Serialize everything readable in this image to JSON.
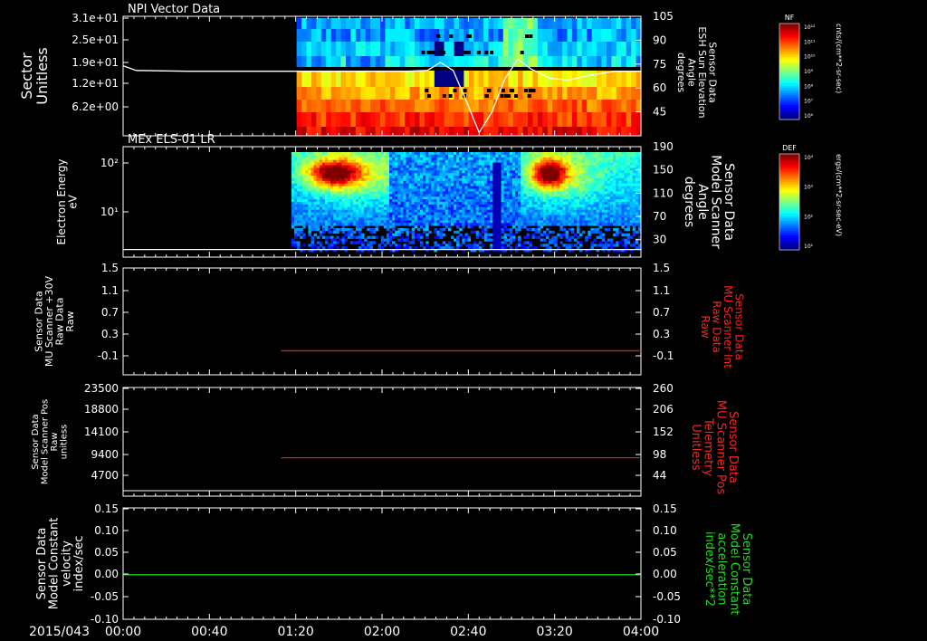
{
  "date_label": "2015/043",
  "time_ticks": [
    "00:00",
    "00:40",
    "01:20",
    "02:00",
    "02:40",
    "03:20",
    "04:00"
  ],
  "colors": {
    "background": "#000000",
    "axis": "#ffffff",
    "red_trace": "#cc2222",
    "green_trace": "#22cc22",
    "red_label": "#ff2020",
    "green_label": "#22dd22"
  },
  "colorbars": [
    {
      "title": "NF",
      "unit_label": "cnts/(cm**2-sr-sec)",
      "tick_labels": [
        "10¹²",
        "10¹¹",
        "10¹⁰",
        "10⁹",
        "10⁸",
        "10⁷",
        "10⁶"
      ]
    },
    {
      "title": "DEF",
      "unit_label": "ergs/(cm**2-sr-sec-eV)",
      "tick_labels": [
        "10⁴",
        "10³",
        "10²",
        "10¹"
      ]
    }
  ],
  "chart_data": [
    {
      "type": "heatmap",
      "title": "NPI Vector Data",
      "ylabel": [
        "Sector",
        "Unitless"
      ],
      "y_ticks": [
        "3.1e+01",
        "2.5e+01",
        "1.9e+01",
        "1.2e+01",
        "6.2e+00"
      ],
      "right_ylabel": [
        "Sensor Data",
        "ESH Sun Elevation",
        "Angle",
        "degrees"
      ],
      "right_ticks": [
        "105",
        "90",
        "75",
        "60",
        "45"
      ],
      "right_ylim": [
        30,
        105
      ],
      "data_start": "01:20",
      "overlay_line": {
        "name": "ESH Sun Elevation",
        "x_hours": [
          0.0,
          0.1,
          0.5,
          1.0,
          1.5,
          2.0,
          2.2,
          2.35,
          2.45,
          2.55,
          2.65,
          2.75,
          2.85,
          2.95,
          3.05,
          3.15,
          3.3,
          3.45,
          3.6,
          3.8,
          4.0
        ],
        "y_deg": [
          74,
          71,
          70.5,
          70.5,
          70.5,
          70.5,
          70.5,
          71,
          76,
          71,
          52,
          32,
          45,
          66,
          78,
          72,
          66,
          65,
          68,
          70.5,
          70.5
        ]
      }
    },
    {
      "type": "heatmap",
      "title": "MEx ELS-01 LR",
      "ylabel": [
        "Electron Energy",
        "eV"
      ],
      "y_ticks": [
        "10²",
        "10¹"
      ],
      "right_ylabel": [
        "Sensor Data",
        "Model Scanner",
        "Angle",
        "degrees"
      ],
      "right_ticks": [
        "190",
        "150",
        "110",
        "70",
        "30"
      ],
      "right_ylim": [
        0,
        190
      ],
      "data_start": "01:20",
      "overlay_line": {
        "name": "Model Scanner Angle",
        "x_hours": [
          0.0,
          4.0
        ],
        "y_deg": [
          13,
          13
        ]
      }
    },
    {
      "type": "line",
      "ylabel": [
        "Sensor Data",
        "MU Scanner +30V",
        "Raw Data",
        "Raw"
      ],
      "y_ticks": [
        "1.5",
        "1.1",
        "0.7",
        "0.3",
        "-0.1"
      ],
      "ylim": [
        -0.5,
        1.5
      ],
      "right_ylabel": [
        "Sensor Data",
        "MU Scanner Int",
        "Raw Data",
        "Raw"
      ],
      "right_ticks": [
        "1.5",
        "1.1",
        "0.7",
        "0.3",
        "-0.1"
      ],
      "series": [
        {
          "x_hours": [
            1.22,
            4.0
          ],
          "values": [
            -0.05,
            -0.05
          ]
        }
      ]
    },
    {
      "type": "line",
      "ylabel": [
        "Sensor Data",
        "Model Scanner Pos",
        "Raw",
        "unitless"
      ],
      "y_ticks": [
        "23500",
        "18800",
        "14100",
        "9400",
        "4700"
      ],
      "ylim": [
        0,
        23500
      ],
      "right_ylabel": [
        "Sensor Data",
        "MU Scanner Pos",
        "Telemetry",
        "Unitless"
      ],
      "right_ticks": [
        "260",
        "206",
        "152",
        "98",
        "44"
      ],
      "series": [
        {
          "x_hours": [
            1.22,
            4.0
          ],
          "values": [
            8300,
            8300
          ]
        }
      ]
    },
    {
      "type": "line",
      "ylabel": [
        "Sensor Data",
        "Model Constant",
        "velocity",
        "index/sec"
      ],
      "y_ticks": [
        "0.15",
        "0.10",
        "0.05",
        "0.00",
        "-0.05",
        "-0.10"
      ],
      "ylim": [
        -0.1,
        0.15
      ],
      "right_ylabel": [
        "Sensor Data",
        "Model Constant",
        "acceleration",
        "index/sec**2"
      ],
      "right_ticks": [
        "0.15",
        "0.10",
        "0.05",
        "0.00",
        "-0.05",
        "-0.10"
      ],
      "series": [
        {
          "x_hours": [
            0.0,
            4.0
          ],
          "values": [
            0.0,
            0.0
          ]
        }
      ]
    }
  ]
}
